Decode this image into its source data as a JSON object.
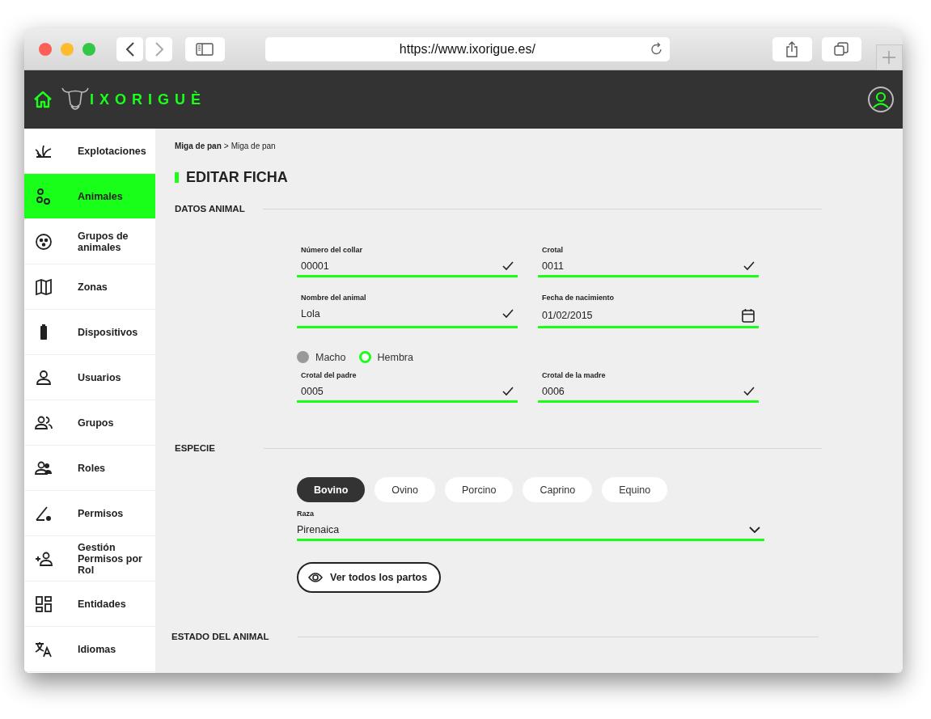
{
  "browser": {
    "url": "https://www.ixorigue.es/"
  },
  "header": {
    "logo": "IXORIGUÈ"
  },
  "sidebar": {
    "items": [
      {
        "label": "Explotaciones",
        "selected": false
      },
      {
        "label": "Animales",
        "selected": true
      },
      {
        "label": "Grupos de animales",
        "selected": false
      },
      {
        "label": "Zonas",
        "selected": false
      },
      {
        "label": "Dispositivos",
        "selected": false
      },
      {
        "label": "Usuarios",
        "selected": false
      },
      {
        "label": "Grupos",
        "selected": false
      },
      {
        "label": "Roles",
        "selected": false
      },
      {
        "label": "Permisos",
        "selected": false
      },
      {
        "label": "Gestión Permisos por Rol",
        "selected": false
      },
      {
        "label": "Entidades",
        "selected": false
      },
      {
        "label": "Idiomas",
        "selected": false
      }
    ]
  },
  "breadcrumb": {
    "parent": "Miga de pan",
    "separator": ">",
    "current": "Miga de pan"
  },
  "title": "EDITAR FICHA",
  "sections": {
    "datos": "DATOS ANIMAL",
    "especie": "ESPECIE",
    "estado": "ESTADO DEL ANIMAL"
  },
  "fields_top": [
    {
      "label": "Número del collar",
      "value": "00001",
      "kind": "check"
    },
    {
      "label": "Crotal",
      "value": "0011",
      "kind": "check"
    },
    {
      "label": "Nombre del animal",
      "value": "Lola",
      "kind": "check"
    },
    {
      "label": "Fecha de nacimiento",
      "value": "01/02/2015",
      "kind": "date"
    }
  ],
  "sex": [
    {
      "label": "Macho",
      "selected": false
    },
    {
      "label": "Hembra",
      "selected": true
    }
  ],
  "fields_parents": [
    {
      "label": "Crotal del padre",
      "value": "0005",
      "kind": "check"
    },
    {
      "label": "Crotal de la madre",
      "value": "0006",
      "kind": "check"
    }
  ],
  "species": [
    {
      "label": "Bovino",
      "selected": true
    },
    {
      "label": "Ovino",
      "selected": false
    },
    {
      "label": "Porcino",
      "selected": false
    },
    {
      "label": "Caprino",
      "selected": false
    },
    {
      "label": "Equino",
      "selected": false
    }
  ],
  "breed": {
    "label": "Raza",
    "value": "Pirenaica",
    "kind": "select"
  },
  "births_button": "Ver todos los partos"
}
